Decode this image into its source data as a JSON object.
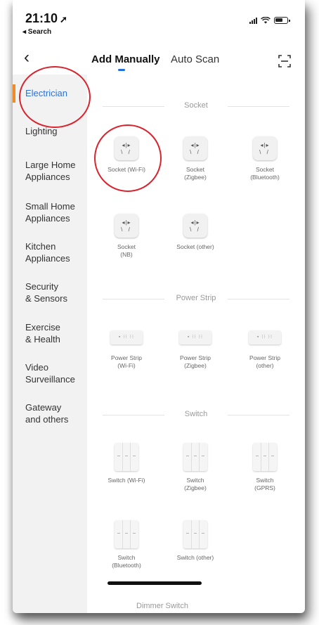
{
  "status_bar": {
    "time": "21:10",
    "back_label": "◂ Search"
  },
  "nav": {
    "tabs": [
      "Add Manually",
      "Auto Scan"
    ],
    "active_tab": 0,
    "accent": "#1e6fd9"
  },
  "sidebar": {
    "active_color": "#2e71d4",
    "indicator_color": "#f08a24",
    "items": [
      "Electrician",
      "Lighting",
      "Large Home\nAppliances",
      "Small Home\nAppliances",
      "Kitchen\nAppliances",
      "Security\n& Sensors",
      "Exercise\n& Health",
      "Video\nSurveillance",
      "Gateway\nand others"
    ]
  },
  "sections": [
    {
      "title": "Socket",
      "icon": "socket-icon",
      "items": [
        "Socket (Wi-Fi)",
        "Socket\n(Zigbee)",
        "Socket\n(Bluetooth)",
        "Socket\n(NB)",
        "Socket (other)"
      ]
    },
    {
      "title": "Power Strip",
      "icon": "power-strip-icon",
      "items": [
        "Power Strip\n(Wi-Fi)",
        "Power Strip\n(Zigbee)",
        "Power Strip\n(other)"
      ]
    },
    {
      "title": "Switch",
      "icon": "switch-icon",
      "items": [
        "Switch (Wi-Fi)",
        "Switch\n(Zigbee)",
        "Switch\n(GPRS)",
        "Switch\n(Bluetooth)",
        "Switch (other)"
      ]
    }
  ],
  "next_section_partial": "Dimmer Switch",
  "annotation_color": "#d9232e"
}
